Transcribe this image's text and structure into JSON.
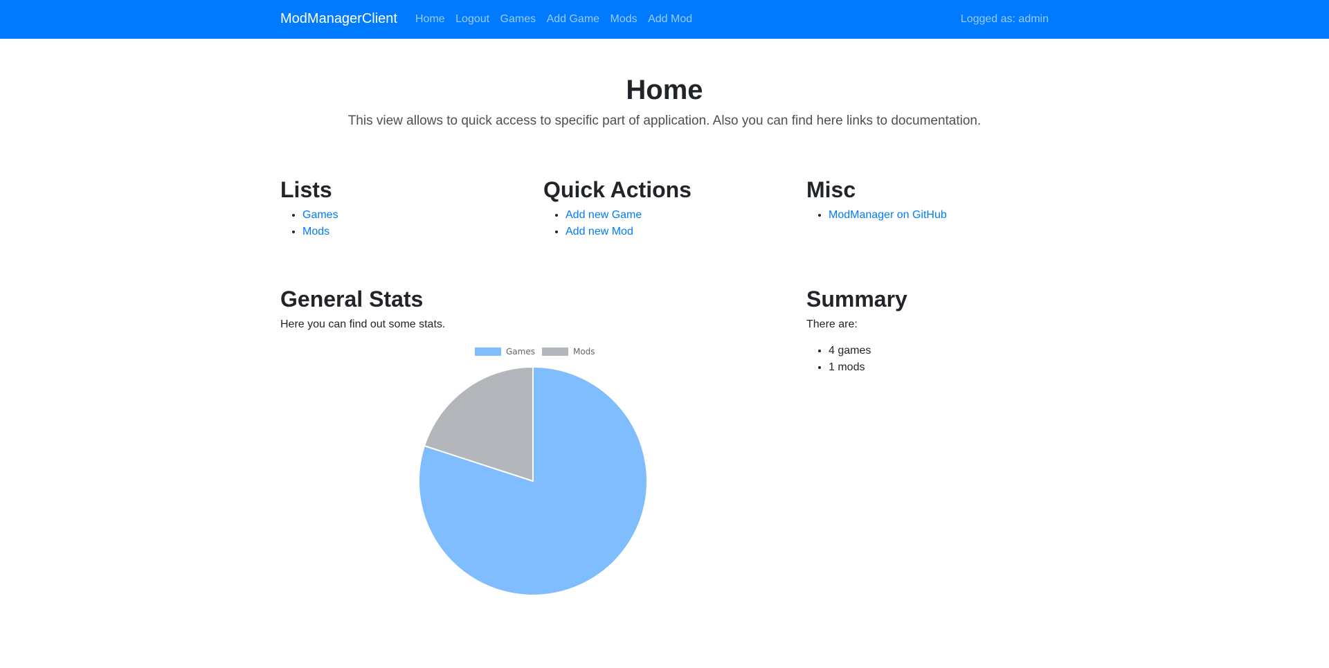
{
  "navbar": {
    "brand": "ModManagerClient",
    "links": [
      "Home",
      "Logout",
      "Games",
      "Add Game",
      "Mods",
      "Add Mod"
    ],
    "user": "Logged as: admin"
  },
  "header": {
    "title": "Home",
    "lead": "This view allows to quick access to specific part of application. Also you can find here links to documentation."
  },
  "lists": {
    "title": "Lists",
    "items": [
      "Games",
      "Mods"
    ]
  },
  "quick_actions": {
    "title": "Quick Actions",
    "items": [
      "Add new Game",
      "Add new Mod"
    ]
  },
  "misc": {
    "title": "Misc",
    "items": [
      "ModManager on GitHub"
    ]
  },
  "general_stats": {
    "title": "General Stats",
    "description": "Here you can find out some stats."
  },
  "summary": {
    "title": "Summary",
    "intro": "There are:",
    "items": [
      "4 games",
      "1 mods"
    ]
  },
  "colors": {
    "accent": "#007bff",
    "games": "#80bdff",
    "mods": "#b3b7bb"
  },
  "chart_data": {
    "type": "pie",
    "categories": [
      "Games",
      "Mods"
    ],
    "values": [
      4,
      1
    ],
    "colors": [
      "#80bdff",
      "#b3b7bb"
    ],
    "legend": "top"
  }
}
